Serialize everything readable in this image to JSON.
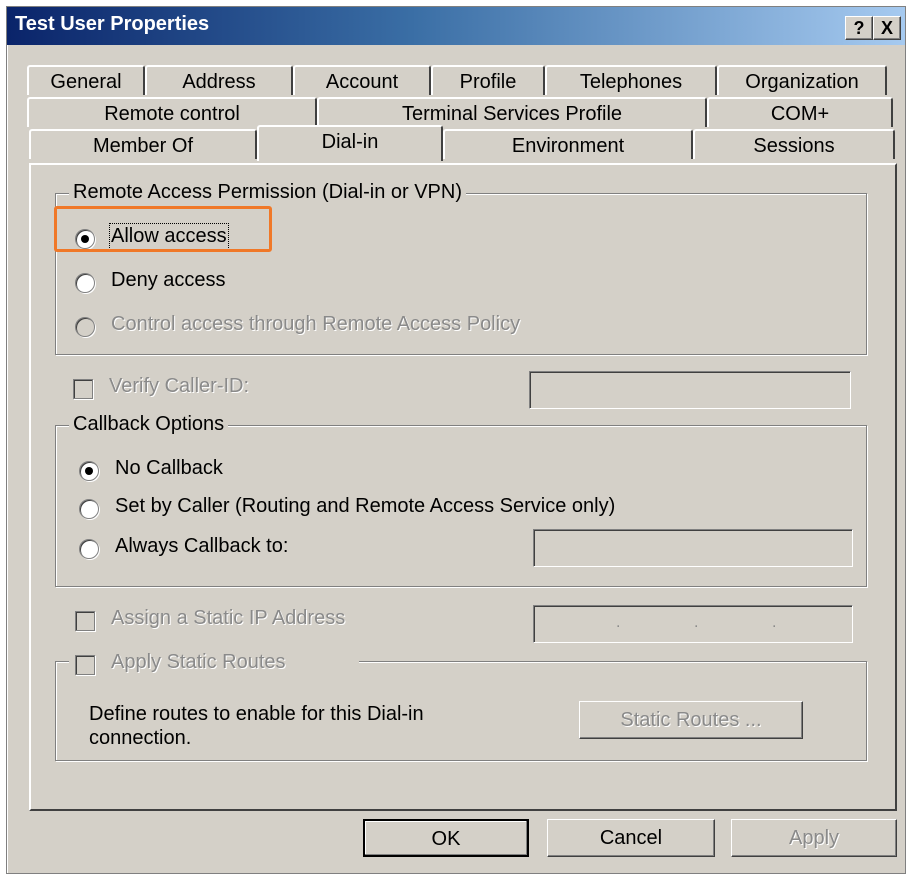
{
  "window": {
    "title": "Test User Properties",
    "help_label": "?",
    "close_label": "X"
  },
  "tabs": {
    "row1": [
      "General",
      "Address",
      "Account",
      "Profile",
      "Telephones",
      "Organization"
    ],
    "row2": [
      "Remote control",
      "Terminal Services Profile",
      "COM+"
    ],
    "row3": [
      "Member Of",
      "Dial-in",
      "Environment",
      "Sessions"
    ],
    "active": "Dial-in"
  },
  "remote_access": {
    "group_label": "Remote Access Permission (Dial-in or VPN)",
    "options": [
      "Allow access",
      "Deny access",
      "Control access through Remote Access Policy"
    ],
    "selected": "Allow access"
  },
  "verify_caller": {
    "label": "Verify Caller-ID:",
    "value": ""
  },
  "callback": {
    "group_label": "Callback Options",
    "options": [
      "No Callback",
      "Set by Caller (Routing and Remote Access Service only)",
      "Always Callback to:"
    ],
    "selected": "No Callback",
    "number": ""
  },
  "static_ip": {
    "label": "Assign a Static IP Address",
    "value": ""
  },
  "static_routes": {
    "label": "Apply Static Routes",
    "description_line1": "Define routes to enable for this Dial-in",
    "description_line2": "connection.",
    "button_label": "Static Routes ..."
  },
  "buttons": {
    "ok": "OK",
    "cancel": "Cancel",
    "apply": "Apply"
  },
  "colors": {
    "highlight": "#f07828",
    "titlebar": "#0a246a",
    "face": "#d4d0c8"
  }
}
